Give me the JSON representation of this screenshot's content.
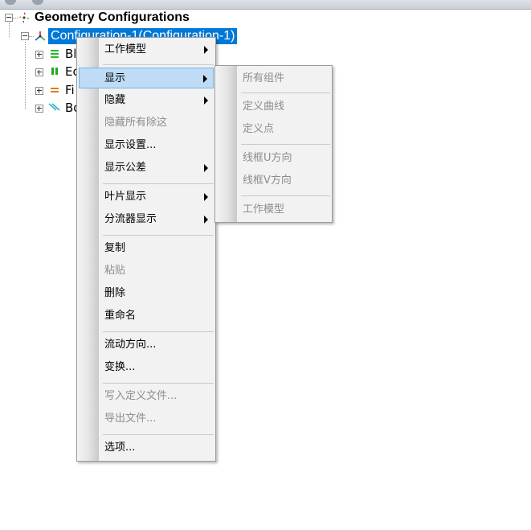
{
  "tree": {
    "root_label": "Geometry Configurations",
    "selected_label": "Configuration-1(Configuration-1)",
    "children": [
      {
        "label": "Bl",
        "icon": "blade-icon",
        "color": "#2db82d"
      },
      {
        "label": "Ec",
        "icon": "endwall-icon",
        "color": "#22aa22"
      },
      {
        "label": "Fi",
        "icon": "fillet-icon",
        "color": "#e07b20"
      },
      {
        "label": "Bo",
        "icon": "boundary-icon",
        "color": "#2fb3c9"
      }
    ]
  },
  "context_menu": {
    "items": [
      "工作模型",
      "显示",
      "隐藏",
      "隐藏所有除这",
      "显示设置...",
      "显示公差",
      "叶片显示",
      "分流器显示",
      "复制",
      "粘贴",
      "删除",
      "重命名",
      "流动方向...",
      "变换...",
      "写入定义文件...",
      "导出文件...",
      "选项..."
    ],
    "highlighted": "显示",
    "disabled": [
      "隐藏所有除这",
      "粘贴",
      "写入定义文件...",
      "导出文件..."
    ]
  },
  "submenu": {
    "items": [
      "所有组件",
      "定义曲线",
      "定义点",
      "线框U方向",
      "线框V方向",
      "工作模型"
    ],
    "all_disabled": true
  },
  "colors": {
    "selection": "#0078d7",
    "menu_highlight": "#bfdbf5",
    "menu_background": "#f2f2f2"
  }
}
